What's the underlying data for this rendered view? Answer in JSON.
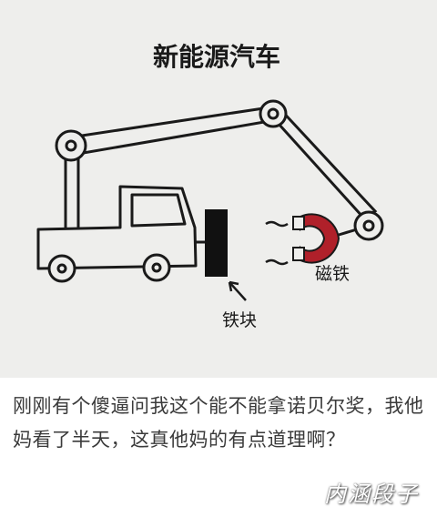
{
  "title": "新能源汽车",
  "labels": {
    "magnet": "磁铁",
    "iron_block": "铁块"
  },
  "caption": "刚刚有个傻逼问我这个能不能拿诺贝尔奖，我他妈看了半天，这真他妈的有点道理啊？",
  "watermark": "内涵段子",
  "colors": {
    "paper": "#eeeeec",
    "ink": "#1a1a1a",
    "magnet_red": "#b0202a",
    "iron_black": "#111111"
  }
}
